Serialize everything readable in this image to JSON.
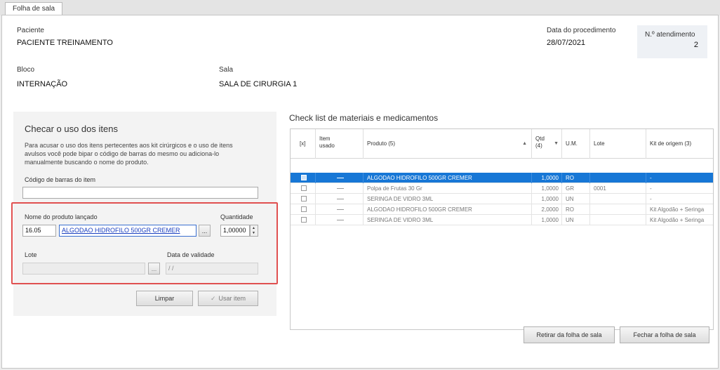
{
  "tab": {
    "label": "Folha de sala"
  },
  "header": {
    "paciente_label": "Paciente",
    "paciente_value": "PACIENTE TREINAMENTO",
    "data_label": "Data do procedimento",
    "data_value": "28/07/2021",
    "atendimento_label": "N.º atendimento",
    "atendimento_value": "2",
    "bloco_label": "Bloco",
    "bloco_value": "INTERNAÇÃO",
    "sala_label": "Sala",
    "sala_value": "SALA DE CIRURGIA 1"
  },
  "left": {
    "title": "Checar o uso dos itens",
    "description": "Para acusar o uso dos itens pertecentes aos kit cirúrgicos e o uso de itens avulsos você pode bipar o código de barras do mesmo ou adiciona-lo manualmente buscando o nome do produto.",
    "barcode_label": "Código de barras do item",
    "barcode_value": "",
    "produto_label": "Nome do produto lançado",
    "produto_code": "16.05",
    "produto_name": "ALGODAO HIDROFILO 500GR CREMER",
    "browse_label": "...",
    "quantidade_label": "Quantidade",
    "quantidade_value": "1,00000",
    "lote_label": "Lote",
    "lote_value": "",
    "lote_browse": "...",
    "validade_label": "Data de validade",
    "validade_value": " / /",
    "limpar_label": "Limpar",
    "usar_label": "Usar item"
  },
  "grid": {
    "title": "Check list de materiais e medicamentos",
    "columns": {
      "check": "[x]",
      "usado": "Item usado",
      "produto": "Produto (5)",
      "qtd": "Qtd (4)",
      "um": "U.M.",
      "lote": "Lote",
      "kit": "Kit de origem (3)"
    },
    "rows": [
      {
        "produto": "ALGODAO HIDROFILO 500GR CREMER",
        "qtd": "1,0000",
        "um": "RO",
        "lote": "",
        "kit": "-"
      },
      {
        "produto": "Polpa de Frutas 30 Gr",
        "qtd": "1,0000",
        "um": "GR",
        "lote": "0001",
        "kit": "-"
      },
      {
        "produto": "SERINGA DE VIDRO 3ML",
        "qtd": "1,0000",
        "um": "UN",
        "lote": "",
        "kit": "-"
      },
      {
        "produto": "ALGODAO HIDROFILO 500GR CREMER",
        "qtd": "2,0000",
        "um": "RO",
        "lote": "",
        "kit": "Kit Algodão + Seringa"
      },
      {
        "produto": "SERINGA DE VIDRO 3ML",
        "qtd": "1,0000",
        "um": "UN",
        "lote": "",
        "kit": "Kit Algodão + Seringa"
      }
    ]
  },
  "footer": {
    "retirar_label": "Retirar da folha de sala",
    "fechar_label": "Fechar a folha de sala"
  },
  "colors": {
    "accent": "#1777d6",
    "highlight_box": "#e05050"
  }
}
